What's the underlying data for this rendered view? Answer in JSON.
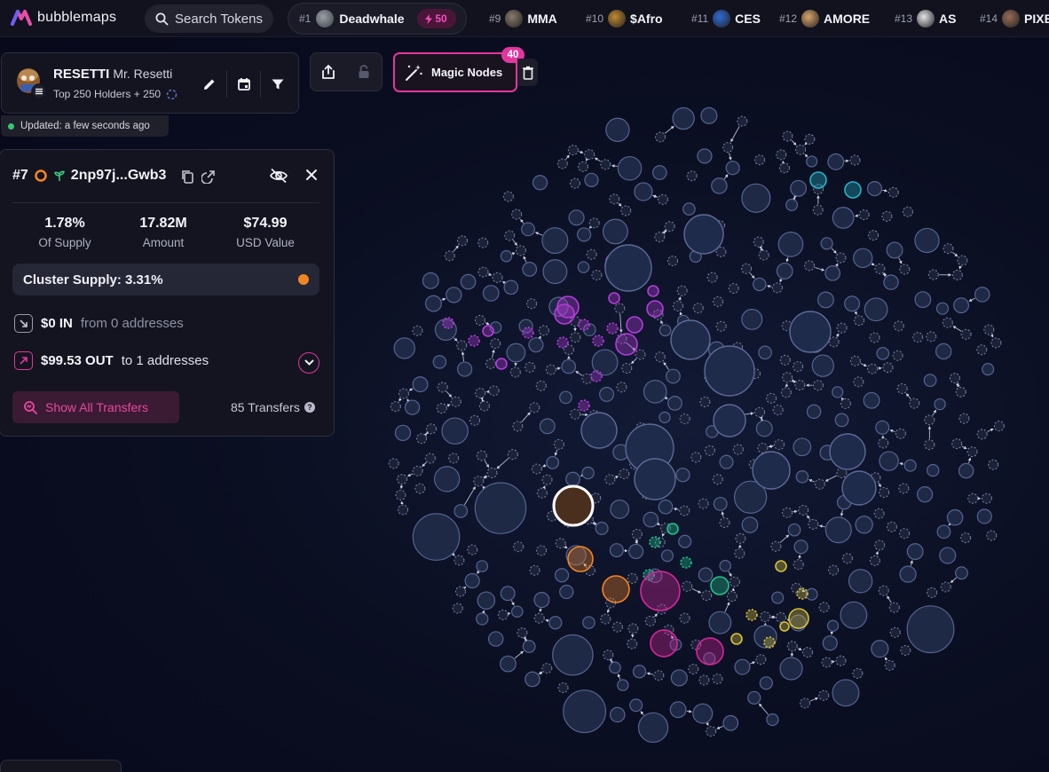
{
  "app": {
    "logo_text": "bubblemaps"
  },
  "search": {
    "placeholder": "Search Tokens"
  },
  "active_token": {
    "rank": "#1",
    "name": "Deadwhale",
    "badge_count": "50"
  },
  "trending_tokens": [
    {
      "rank": "#9",
      "name": "MMA",
      "icon": "mma-token-icon",
      "color": "#8a7a6a"
    },
    {
      "rank": "#10",
      "name": "$Afro",
      "icon": "afro-token-icon",
      "color": "#c28a2e"
    },
    {
      "rank": "#11",
      "name": "CES",
      "icon": "ces-token-icon",
      "color": "#2f6ad8"
    },
    {
      "rank": "#12",
      "name": "AMORE",
      "icon": "amore-token-icon",
      "color": "#d9a46a"
    },
    {
      "rank": "#13",
      "name": "AS",
      "icon": "as-token-icon",
      "color": "#e2e2e8"
    },
    {
      "rank": "#14",
      "name": "PIXE",
      "icon": "pixe-token-icon",
      "color": "#9a6b55"
    }
  ],
  "token_card": {
    "name": "RESETTI",
    "full_name": "Mr. Resetti",
    "holders_label": "Top 250 Holders + 250",
    "updated": "Updated: a few seconds ago"
  },
  "toolbar": {
    "magic_nodes_label": "Magic Nodes",
    "magic_nodes_count": "40"
  },
  "wallet": {
    "rank": "#7",
    "address": "2np97j...Gwb3",
    "stats": [
      {
        "value": "1.78%",
        "label": "Of Supply"
      },
      {
        "value": "17.82M",
        "label": "Amount"
      },
      {
        "value": "$74.99",
        "label": "USD Value"
      }
    ],
    "cluster_supply": "Cluster Supply: 3.31%",
    "cluster_color": "#f28425",
    "in_value": "$0 IN",
    "in_from": "from 0 addresses",
    "out_value": "$99.53 OUT",
    "out_to": "to 1 addresses",
    "show_all_label": "Show All Transfers",
    "transfers_count": "85 Transfers"
  },
  "colors": {
    "accent": "#e2369f",
    "node": "#243050",
    "purple_cluster": "#b43cdb",
    "orange_cluster": "#f28425",
    "green_cluster": "#22c48a",
    "yellow_cluster": "#d9c23a",
    "cyan_cluster": "#27b3c7",
    "pink_cluster": "#d8259a"
  }
}
